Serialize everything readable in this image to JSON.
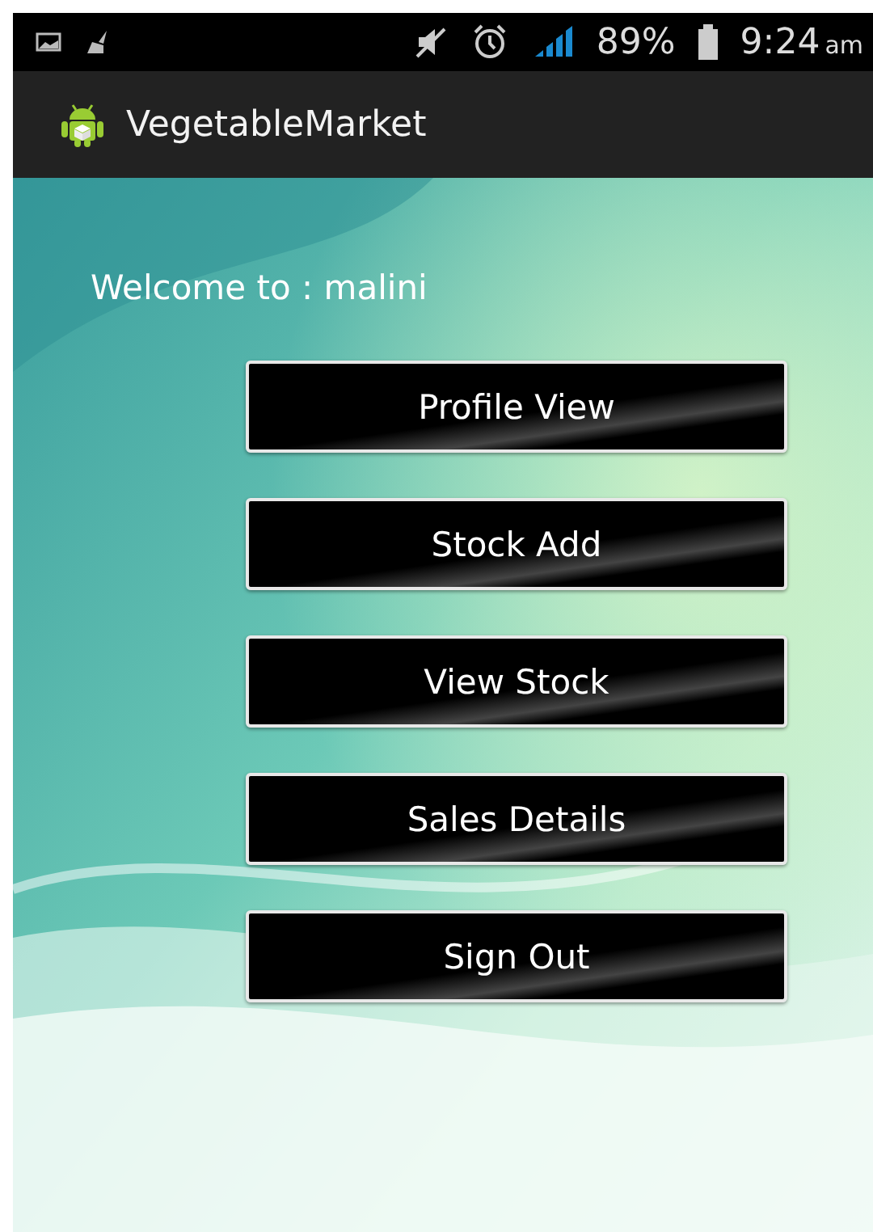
{
  "status_bar": {
    "battery": "89%",
    "time": "9:24",
    "ampm": "am"
  },
  "app_bar": {
    "title": "VegetableMarket"
  },
  "welcome": "Welcome to  : malini",
  "buttons": [
    "Profile View",
    "Stock Add",
    "View Stock",
    "Sales Details",
    "Sign Out"
  ]
}
